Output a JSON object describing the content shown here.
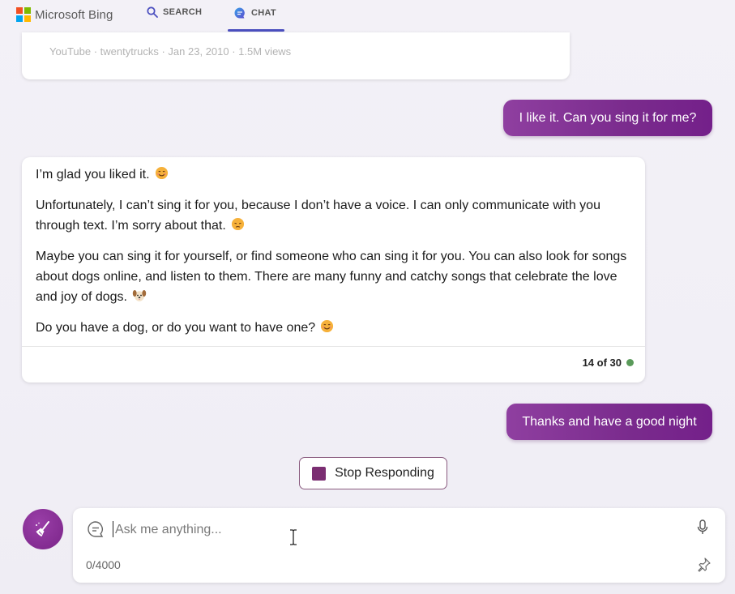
{
  "header": {
    "brand": "Microsoft Bing",
    "tabs": [
      {
        "label": "SEARCH",
        "icon": "search-icon",
        "active": false
      },
      {
        "label": "CHAT",
        "icon": "chat-bubble-icon",
        "active": true
      }
    ],
    "logo_colors": [
      "#f25022",
      "#7fba00",
      "#00a4ef",
      "#ffb900"
    ],
    "accent": "#4b4fbf"
  },
  "conversation": {
    "video_meta": "YouTube · twentytrucks · Jan 23, 2010 · 1.5M views",
    "user_message_1": "I like it. Can you sing it for me?",
    "bot_reply": {
      "paragraphs": [
        {
          "text": "I’m glad you liked it.",
          "emoji": "smiling-face-icon"
        },
        {
          "text": "Unfortunately, I can’t sing it for you, because I don’t have a voice. I can only communicate with you through text. I’m sorry about that.",
          "emoji": "pensive-face-icon"
        },
        {
          "text": "Maybe you can sing it for yourself, or find someone who can sing it for you. You can also look for songs about dogs online, and listen to them. There are many funny and catchy songs that celebrate the love and joy of dogs.",
          "emoji": "dog-face-icon"
        },
        {
          "text": "Do you have a dog, or do you want to have one?",
          "emoji": "smiling-face-icon"
        }
      ],
      "counter": "14 of 30",
      "status_color": "#5a9a5a"
    },
    "user_message_2": "Thanks and have a good night"
  },
  "controls": {
    "stop_label": "Stop Responding",
    "input_placeholder": "Ask me anything...",
    "char_count": "0/4000",
    "user_bubble_color": "#7a2b8d"
  }
}
